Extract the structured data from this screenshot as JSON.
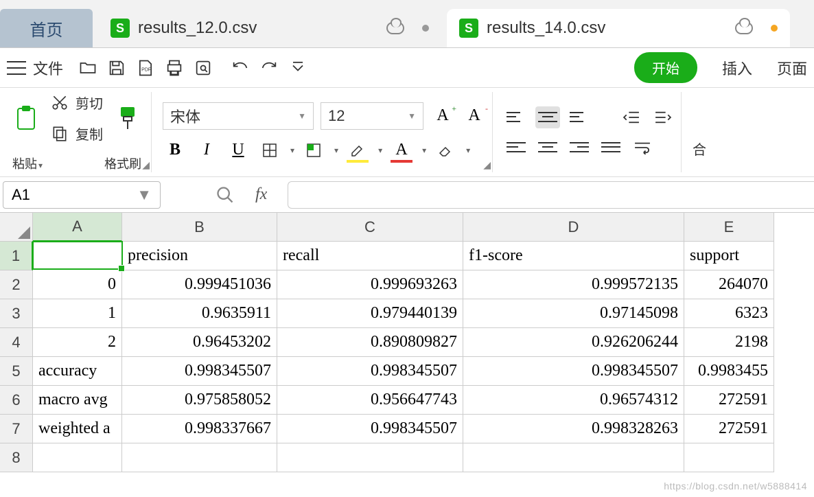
{
  "tabs": {
    "home": "首页",
    "files": [
      {
        "name": "results_12.0.csv",
        "active": false,
        "modified": false
      },
      {
        "name": "results_14.0.csv",
        "active": true,
        "modified": true
      }
    ]
  },
  "toolbar": {
    "file_label": "文件",
    "start_pill": "开始",
    "insert": "插入",
    "page": "页面"
  },
  "ribbon": {
    "paste": "粘贴",
    "cut": "剪切",
    "copy": "复制",
    "format_painter": "格式刷",
    "font_name": "宋体",
    "font_size": "12",
    "merge": "合"
  },
  "cell_ref": "A1",
  "fx_label": "fx",
  "columns": [
    "A",
    "B",
    "C",
    "D",
    "E"
  ],
  "row_numbers": [
    "1",
    "2",
    "3",
    "4",
    "5",
    "6",
    "7",
    "8"
  ],
  "grid": {
    "r1": {
      "A": "",
      "B": "precision",
      "C": "recall",
      "D": "f1-score",
      "E": "support"
    },
    "r2": {
      "A": "0",
      "B": "0.999451036",
      "C": "0.999693263",
      "D": "0.999572135",
      "E": "264070"
    },
    "r3": {
      "A": "1",
      "B": "0.9635911",
      "C": "0.979440139",
      "D": "0.97145098",
      "E": "6323"
    },
    "r4": {
      "A": "2",
      "B": "0.96453202",
      "C": "0.890809827",
      "D": "0.926206244",
      "E": "2198"
    },
    "r5": {
      "A": "accuracy",
      "B": "0.998345507",
      "C": "0.998345507",
      "D": "0.998345507",
      "E": "0.9983455"
    },
    "r6": {
      "A": "macro avg",
      "B": "0.975858052",
      "C": "0.956647743",
      "D": "0.96574312",
      "E": "272591"
    },
    "r7": {
      "A": "weighted a",
      "B": "0.998337667",
      "C": "0.998345507",
      "D": "0.998328263",
      "E": "272591"
    },
    "r8": {
      "A": "",
      "B": "",
      "C": "",
      "D": "",
      "E": ""
    }
  },
  "watermark": "https://blog.csdn.net/w5888414"
}
